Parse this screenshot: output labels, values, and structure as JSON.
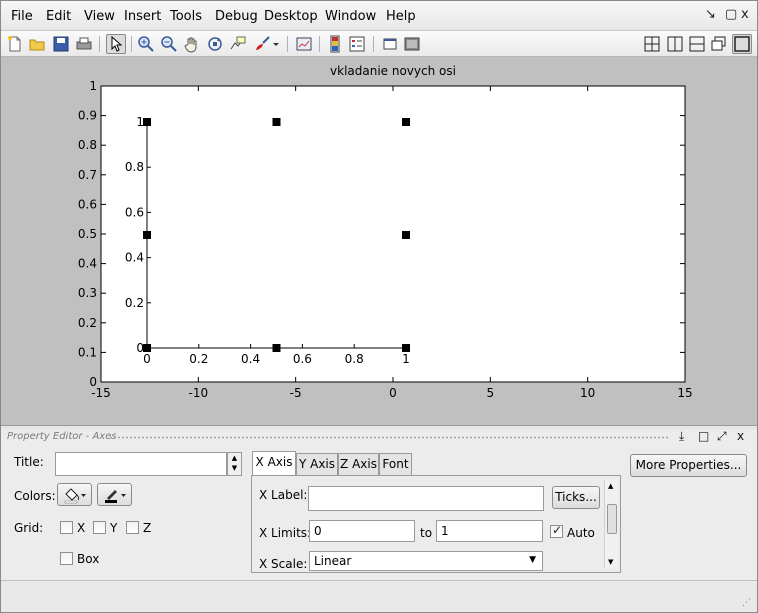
{
  "menubar": {
    "items": [
      "File",
      "Edit",
      "View",
      "Insert",
      "Tools",
      "Debug",
      "Desktop",
      "Window",
      "Help"
    ],
    "controls": [
      "↘",
      "x"
    ]
  },
  "toolbar": {
    "left_icons": [
      "new-file",
      "open-folder",
      "save",
      "print",
      "edit-plot-pointer",
      "zoom-in",
      "zoom-out",
      "pan-hand",
      "rotate-3d",
      "data-cursor",
      "brush",
      "link-plot",
      "colorbar",
      "legend",
      "hide-plot-tools",
      "show-plot-tools"
    ],
    "right_icons": [
      "tile-grid",
      "split-vertical",
      "split-horizontal",
      "float-window",
      "maximize-window"
    ]
  },
  "chart_data": [
    {
      "type": "scatter",
      "title": "vkladanie novych osi",
      "xlim": [
        -15,
        15
      ],
      "ylim": [
        0,
        1
      ],
      "xticks": [
        "-15",
        "-10",
        "-5",
        "0",
        "5",
        "10",
        "15"
      ],
      "yticks": [
        "0",
        "0.1",
        "0.2",
        "0.3",
        "0.4",
        "0.5",
        "0.6",
        "0.7",
        "0.8",
        "0.9",
        "1"
      ],
      "grid": false
    },
    {
      "type": "scatter",
      "title": "",
      "xlim": [
        0,
        1
      ],
      "ylim": [
        0,
        1
      ],
      "xticks": [
        "0",
        "0.2",
        "0.4",
        "0.6",
        "0.8",
        "1"
      ],
      "yticks": [
        "0",
        "0.2",
        "0.4",
        "0.6",
        "0.8",
        "1"
      ],
      "selected": true,
      "handles": [
        [
          0,
          0
        ],
        [
          0.5,
          0
        ],
        [
          1,
          0
        ],
        [
          0,
          0.5
        ],
        [
          1,
          0.5
        ],
        [
          0,
          1
        ],
        [
          0.5,
          1
        ],
        [
          1,
          1
        ]
      ]
    }
  ],
  "property_editor": {
    "title_bar": "Property Editor - Axes",
    "title_controls": [
      "⤓",
      "□",
      "⤢",
      "x"
    ],
    "title_label": "Title:",
    "title_value": "",
    "colors_label": "Colors:",
    "grid_label": "Grid:",
    "grid_x": "X",
    "grid_y": "Y",
    "grid_z": "Z",
    "box_label": "Box",
    "tabs": [
      "X Axis",
      "Y Axis",
      "Z Axis",
      "Font"
    ],
    "xlabel_label": "X Label:",
    "xlabel_value": "",
    "ticks_button": "Ticks...",
    "xlimits_label": "X Limits:",
    "xlim_from": "0",
    "to_label": "to",
    "xlim_to": "1",
    "auto_label": "Auto",
    "auto_checked": true,
    "xscale_label": "X Scale:",
    "xscale_value": "Linear",
    "more_properties": "More Properties..."
  }
}
